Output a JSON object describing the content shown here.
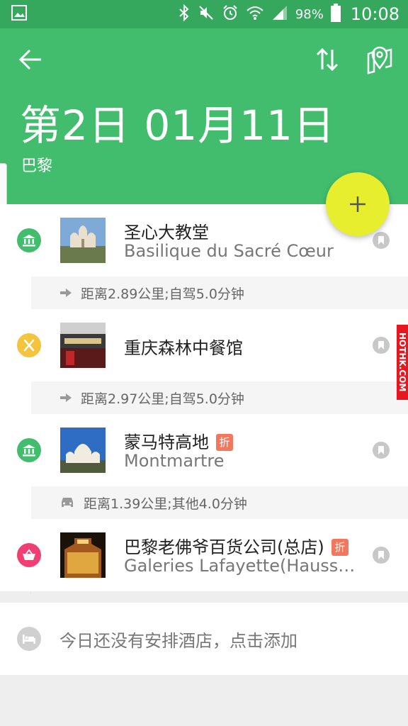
{
  "status_bar": {
    "battery": "98%",
    "time": "10:08",
    "icons": [
      "gallery-icon",
      "bluetooth-icon",
      "mute-icon",
      "alarm-icon",
      "wifi-icon",
      "signal-icon",
      "battery-icon"
    ]
  },
  "header": {
    "title": "第2日 01月11日",
    "city": "巴黎",
    "color": "#42bd6e"
  },
  "places": [
    {
      "name": "圣心大教堂",
      "en_name": "Basilique du Sacré  Cœur",
      "category": "museum",
      "category_color": "#42bd6e",
      "discount": ""
    },
    {
      "name": "重庆森林中餐馆",
      "en_name": "",
      "category": "restaurant",
      "category_color": "#f3c43c",
      "discount": ""
    },
    {
      "name": "蒙马特高地",
      "en_name": "Montmartre",
      "category": "museum",
      "category_color": "#42bd6e",
      "discount": "折"
    },
    {
      "name": "巴黎老佛爷百货公司(总店)",
      "en_name": "Galeries Lafayette(Hauss…",
      "category": "shopping",
      "category_color": "#f03f73",
      "discount": "折"
    }
  ],
  "routes": [
    {
      "mode": "arrow",
      "text": "距离2.89公里;自驾5.0分钟"
    },
    {
      "mode": "arrow",
      "text": "距离2.97公里;自驾5.0分钟"
    },
    {
      "mode": "car",
      "text": "距离1.39公里;其他4.0分钟"
    }
  ],
  "hotel": {
    "text": "今日还没有安排酒店，点击添加"
  },
  "watermark": "HOTHK.COM",
  "fab_color": "#e6ee2e"
}
